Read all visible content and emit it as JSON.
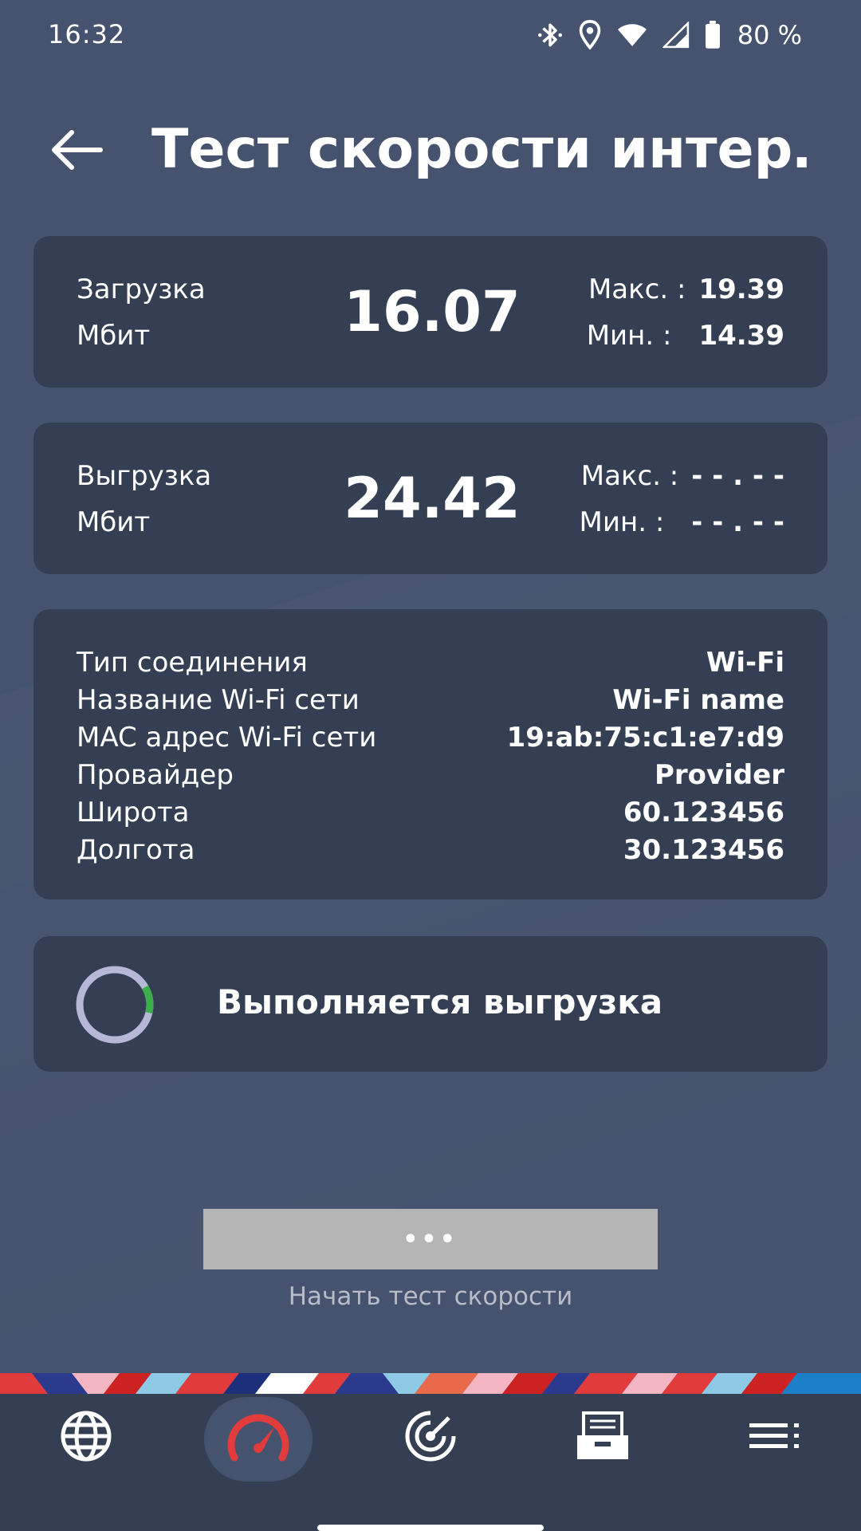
{
  "status_bar": {
    "time": "16:32",
    "battery": "80 %"
  },
  "header": {
    "title": "Тест скорости интер…"
  },
  "download": {
    "label": "Загрузка",
    "unit": "Мбит",
    "value": "16.07",
    "max_label": "Макс. :",
    "max_value": "19.39",
    "min_label": "Мин. :",
    "min_value": "14.39"
  },
  "upload": {
    "label": "Выгрузка",
    "unit": "Мбит",
    "value": "24.42",
    "max_label": "Макс. :",
    "max_value": "- - . - -",
    "min_label": "Мин. :",
    "min_value": "- - . - -"
  },
  "info": [
    {
      "label": "Тип соединения",
      "value": "Wi-Fi"
    },
    {
      "label": "Название Wi-Fi сети",
      "value": "Wi-Fi name"
    },
    {
      "label": "MAC адрес Wi-Fi сети",
      "value": "19:ab:75:c1:e7:d9"
    },
    {
      "label": "Провайдер",
      "value": "Provider"
    },
    {
      "label": "Широта",
      "value": "60.123456"
    },
    {
      "label": "Долгота",
      "value": "30.123456"
    }
  ],
  "progress": {
    "text": "Выполняется выгрузка",
    "fraction": 0.12
  },
  "start": {
    "button_label": "•••",
    "caption": "Начать тест скорости"
  },
  "nav": {
    "items": [
      "globe-icon",
      "speedometer-icon",
      "radar-icon",
      "archive-icon",
      "menu-list-icon"
    ],
    "active_index": 1
  },
  "colors": {
    "background": "#46536e",
    "card": "#343f53",
    "accent_red": "#e23b3b",
    "progress_green": "#3cae4a",
    "spinner_track": "#b6b9d6",
    "button_gray": "#b5b5b5"
  }
}
